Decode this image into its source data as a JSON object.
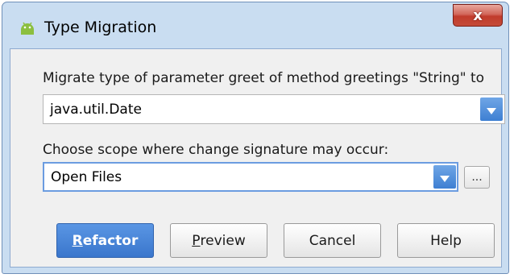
{
  "window": {
    "title": "Type Migration",
    "app_icon": "android-icon",
    "close_label": "x"
  },
  "dialog": {
    "prompt": "Migrate type of parameter greet of method greetings \"String\" to",
    "type_value": "java.util.Date",
    "scope_label": "Choose scope where change signature may occur:",
    "scope_value": "Open Files",
    "ellipsis_label": "..."
  },
  "buttons": {
    "refactor": {
      "mnemonic": "R",
      "rest": "efactor"
    },
    "preview": {
      "mnemonic": "P",
      "rest": "review"
    },
    "cancel": "Cancel",
    "help": "Help"
  },
  "colors": {
    "frame": "#c9ddf1",
    "client": "#f0f0f0",
    "accent": "#4a86d8",
    "close": "#c44b39"
  }
}
